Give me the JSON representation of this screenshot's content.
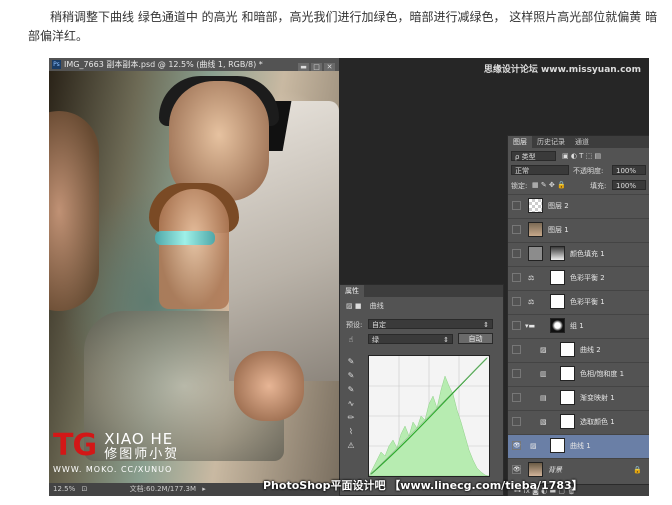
{
  "article": {
    "text": "稍稍调整下曲线 绿色通道中 的高光 和暗部，高光我们进行加绿色，暗部进行减绿色， 这样照片高光部位就偏黄 暗部偏洋红。"
  },
  "document": {
    "title": "IMG_7663 副本副本.psd @ 12.5% (曲线 1, RGB/8) *",
    "ps_badge": "Ps",
    "zoom": "12.5%",
    "file_info": "文档:60.2M/177.3M"
  },
  "photo_logo": {
    "tg": "TG",
    "english": "XIAO HE",
    "chinese": "修图师小贺",
    "url": "WWW. MOKO. CC/XUNUO"
  },
  "brand": "思缘设计论坛 www.missyuan.com",
  "properties": {
    "tab": "属性",
    "panel_title": "曲线",
    "preset_label": "预设:",
    "preset_value": "自定",
    "channel_value": "绿",
    "auto_button": "自动"
  },
  "layers_panel": {
    "tabs": [
      "图层",
      "历史记录",
      "通道"
    ],
    "filter_label": "ρ 类型",
    "blend_mode": "正常",
    "opacity_label": "不透明度:",
    "opacity_value": "100%",
    "lock_label": "锁定:",
    "fill_label": "填充:",
    "fill_value": "100%",
    "layers": [
      {
        "name": "图层 2"
      },
      {
        "name": "图层 1"
      },
      {
        "name": "颜色填充 1"
      },
      {
        "name": "色彩平衡 2"
      },
      {
        "name": "色彩平衡 1"
      },
      {
        "name": "组 1"
      },
      {
        "name": "曲线 2"
      },
      {
        "name": "色相/饱和度 1"
      },
      {
        "name": "渐变映射 1"
      },
      {
        "name": "选取颜色 1"
      },
      {
        "name": "曲线 1"
      },
      {
        "name": "背景"
      }
    ]
  },
  "footer_watermark": "PhotoShop平面设计吧 【www.linecg.com/tieba/1783】"
}
